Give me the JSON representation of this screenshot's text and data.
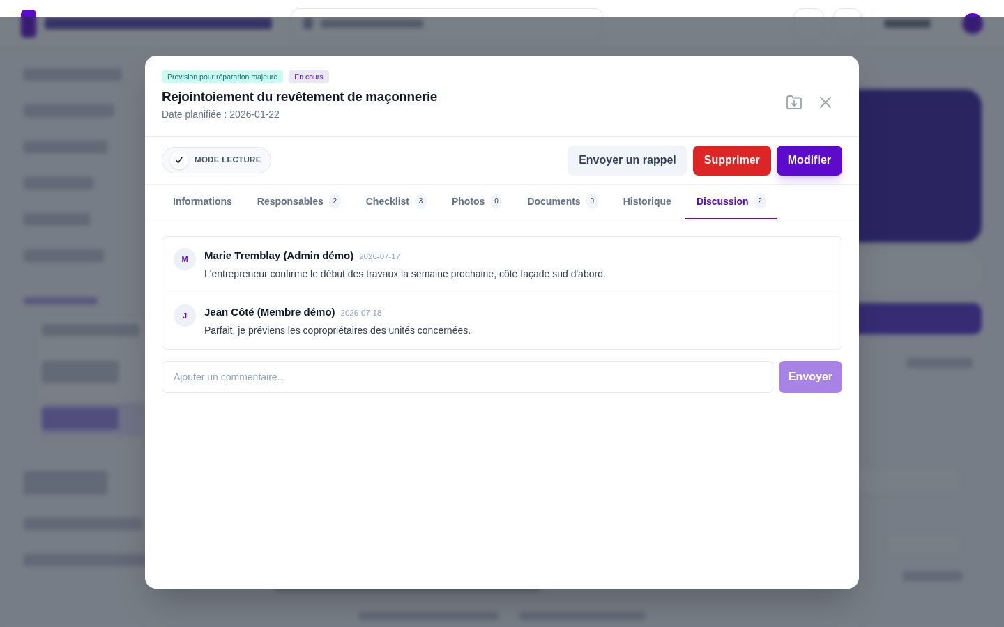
{
  "modal": {
    "badges": [
      {
        "label": "Provision pour réparation majeure",
        "kind": "category"
      },
      {
        "label": "En cours",
        "kind": "status"
      }
    ],
    "title": "Rejointoiement du revêtement de maçonnerie",
    "subtitle": "Date planifiée : 2026-01-22",
    "read_mode": {
      "label": "MODE LECTURE",
      "checked": true
    },
    "actions": [
      {
        "label": "Envoyer un rappel",
        "kind": "secondary"
      },
      {
        "label": "Supprimer",
        "kind": "danger"
      },
      {
        "label": "Modifier",
        "kind": "primary"
      }
    ],
    "tabs": [
      {
        "label": "Informations",
        "selected": false
      },
      {
        "label": "Responsables",
        "count": "2",
        "selected": false
      },
      {
        "label": "Checklist",
        "count": "3",
        "selected": false
      },
      {
        "label": "Photos",
        "count": "0",
        "selected": false
      },
      {
        "label": "Documents",
        "count": "0",
        "selected": false
      },
      {
        "label": "Historique",
        "selected": false
      },
      {
        "label": "Discussion",
        "count": "2",
        "selected": true
      }
    ],
    "comments": [
      {
        "initial": "M",
        "author": "Marie Tremblay (Admin démo)",
        "date": "2026-07-17",
        "text": "L'entrepreneur confirme le début des travaux la semaine prochaine, côté façade sud d'abord."
      },
      {
        "initial": "J",
        "author": "Jean Côté (Membre démo)",
        "date": "2026-07-18",
        "text": "Parfait, je préviens les copropriétaires des unités concernées."
      }
    ],
    "comment_input": {
      "placeholder": "Ajouter un commentaire...",
      "button": "Envoyer",
      "disabled": true
    }
  }
}
